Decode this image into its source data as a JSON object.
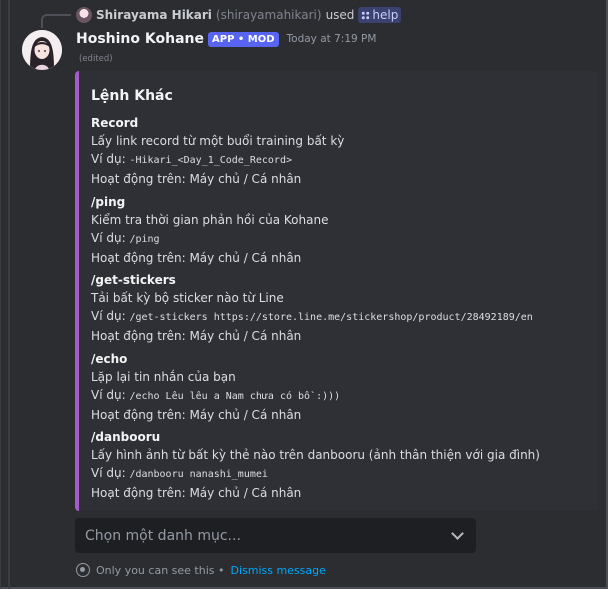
{
  "reply": {
    "name": "Shirayama Hikari",
    "handle": "(shirayamahikari)",
    "used": "used",
    "command": "help"
  },
  "message": {
    "author": "Hoshino Kohane",
    "tag": "APP • MOD",
    "timestamp": "Today at 7:19 PM",
    "edited": "(edited)"
  },
  "embed": {
    "accent_color": "#a35cc9",
    "title": "Lệnh Khác",
    "fields": [
      {
        "name": "Record",
        "desc": "Lấy link record từ một buổi training bất kỳ",
        "example_label": "Ví dụ: ",
        "example_code": "-Hikari_<Day_1_Code_Record>",
        "works_on": "Hoạt động trên: Máy chủ / Cá nhân"
      },
      {
        "name": "/ping",
        "desc": "Kiểm tra thời gian phản hồi của Kohane",
        "example_label": "Ví dụ: ",
        "example_code": "/ping",
        "works_on": "Hoạt động trên: Máy chủ / Cá nhân"
      },
      {
        "name": "/get-stickers",
        "desc": "Tải bất kỳ bộ sticker nào từ Line",
        "example_label": "Ví dụ: ",
        "example_code": "/get-stickers https://store.line.me/stickershop/product/28492189/en",
        "works_on": "Hoạt động trên: Máy chủ / Cá nhân"
      },
      {
        "name": "/echo",
        "desc": "Lặp lại tin nhắn của bạn",
        "example_label": "Ví dụ: ",
        "example_code": "/echo Lêu lêu a Nam chưa có bồ :)))",
        "works_on": "Hoạt động trên: Máy chủ / Cá nhân"
      },
      {
        "name": "/danbooru",
        "desc": "Lấy hình ảnh từ bất kỳ thẻ nào trên danbooru (ảnh thân thiện với gia đình)",
        "example_label": "Ví dụ: ",
        "example_code": "/danbooru nanashi_mumei",
        "works_on": "Hoạt động trên: Máy chủ / Cá nhân"
      }
    ]
  },
  "select": {
    "placeholder": "Chọn một danh mục..."
  },
  "ephemeral": {
    "notice": "Only you can see this •",
    "dismiss": "Dismiss message"
  },
  "icons": {
    "reply_avatar": "mini-avatar-icon",
    "command": "grid-icon",
    "dropdown": "chevron-down-icon",
    "visibility": "eye-icon"
  },
  "colors": {
    "background": "#2b2d31",
    "app_tag": "#5865f2",
    "link": "#00a8fc"
  }
}
